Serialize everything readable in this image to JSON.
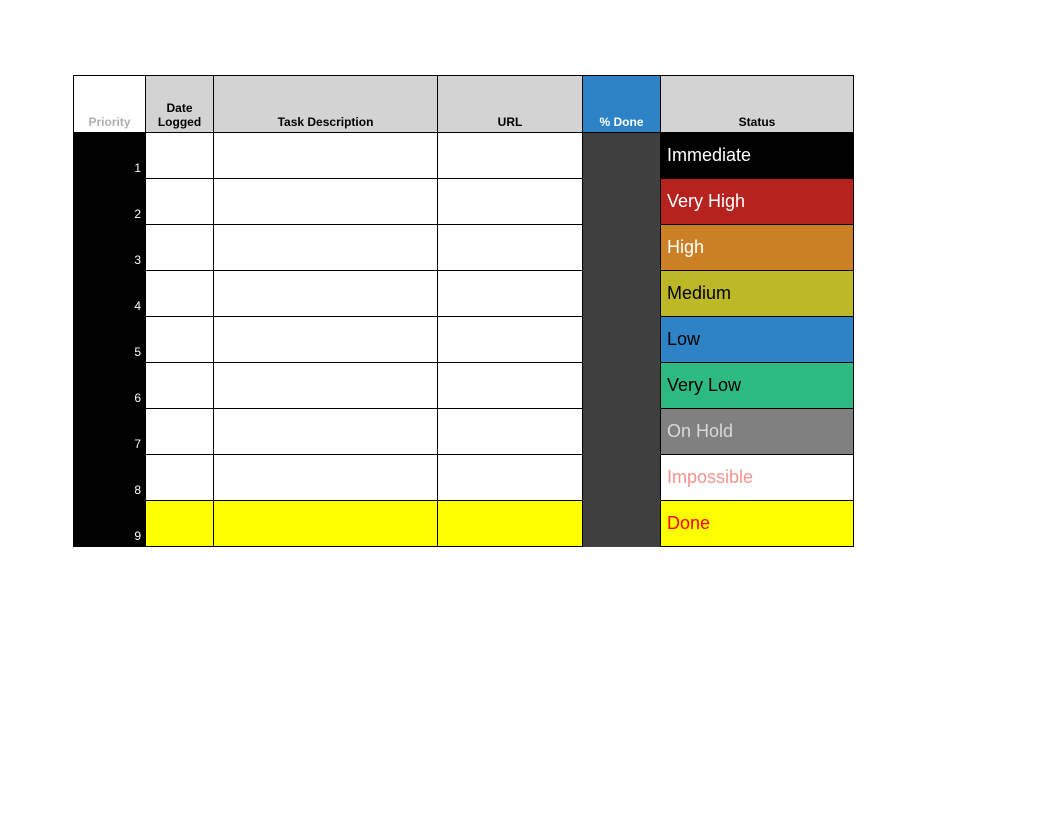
{
  "headers": {
    "priority": "Priority",
    "date_logged": "Date Logged",
    "task_description": "Task Description",
    "url": "URL",
    "pct_done": "% Done",
    "status": "Status"
  },
  "rows": [
    {
      "priority": "1",
      "date": "",
      "desc": "",
      "url": "",
      "done": "",
      "row_bg": "white",
      "status_label": "Immediate",
      "status_bg": "#000000",
      "status_fg": "#ffffff"
    },
    {
      "priority": "2",
      "date": "",
      "desc": "",
      "url": "",
      "done": "",
      "row_bg": "white",
      "status_label": "Very High",
      "status_bg": "#b6231f",
      "status_fg": "#ffffff"
    },
    {
      "priority": "3",
      "date": "",
      "desc": "",
      "url": "",
      "done": "",
      "row_bg": "white",
      "status_label": "High",
      "status_bg": "#cb8026",
      "status_fg": "#ffffff"
    },
    {
      "priority": "4",
      "date": "",
      "desc": "",
      "url": "",
      "done": "",
      "row_bg": "white",
      "status_label": "Medium",
      "status_bg": "#bcb826",
      "status_fg": "#000000"
    },
    {
      "priority": "5",
      "date": "",
      "desc": "",
      "url": "",
      "done": "",
      "row_bg": "white",
      "status_label": "Low",
      "status_bg": "#2e83c6",
      "status_fg": "#000000"
    },
    {
      "priority": "6",
      "date": "",
      "desc": "",
      "url": "",
      "done": "",
      "row_bg": "white",
      "status_label": "Very Low",
      "status_bg": "#2dba80",
      "status_fg": "#000000"
    },
    {
      "priority": "7",
      "date": "",
      "desc": "",
      "url": "",
      "done": "",
      "row_bg": "white",
      "status_label": "On Hold",
      "status_bg": "#808080",
      "status_fg": "#d9d9d9"
    },
    {
      "priority": "8",
      "date": "",
      "desc": "",
      "url": "",
      "done": "",
      "row_bg": "white",
      "status_label": "Impossible",
      "status_bg": "#ffffff",
      "status_fg": "#f4948f"
    },
    {
      "priority": "9",
      "date": "",
      "desc": "",
      "url": "",
      "done": "",
      "row_bg": "yellow",
      "status_label": "Done",
      "status_bg": "#ffff00",
      "status_fg": "#ff0000"
    }
  ]
}
